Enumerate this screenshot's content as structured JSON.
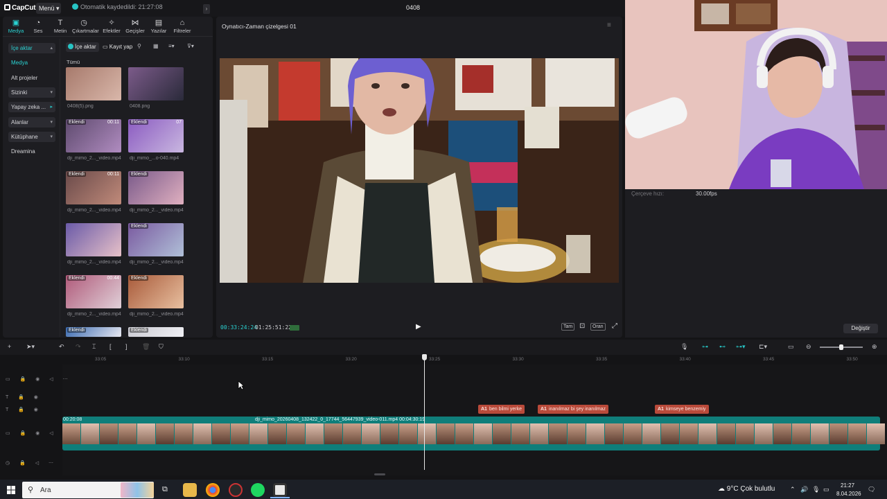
{
  "titlebar": {
    "logo": "CapCut",
    "menu_label": "Menü",
    "autosave": "Otomatik kaydedildi: 21:27:08",
    "project_name": "0408"
  },
  "tool_tabs": [
    {
      "label": "Medya",
      "icon": "media-icon",
      "glyph": "▣"
    },
    {
      "label": "Ses",
      "icon": "audio-icon",
      "glyph": "◔"
    },
    {
      "label": "Metin",
      "icon": "text-icon",
      "glyph": "T"
    },
    {
      "label": "Çıkartmalar",
      "icon": "sticker-icon",
      "glyph": "◷"
    },
    {
      "label": "Efektler",
      "icon": "effects-icon",
      "glyph": "✧"
    },
    {
      "label": "Geçişler",
      "icon": "transitions-icon",
      "glyph": "⋈"
    },
    {
      "label": "Yazılar",
      "icon": "captions-icon",
      "glyph": "▤"
    },
    {
      "label": "Filtreler",
      "icon": "filters-icon",
      "glyph": "⌂"
    }
  ],
  "sidebar": {
    "items": [
      {
        "label": "İçe aktar",
        "chev": "▴"
      },
      {
        "label": "Medya",
        "chev": ""
      },
      {
        "label": "Alt projeler",
        "chev": ""
      },
      {
        "label": "Sizinki",
        "chev": "▾"
      },
      {
        "label": "Yapay zeka ...",
        "chev": "▸"
      },
      {
        "label": "Alanlar",
        "chev": "▾"
      },
      {
        "label": "Kütüphane",
        "chev": "▾"
      },
      {
        "label": "Dreamina",
        "chev": ""
      }
    ]
  },
  "media": {
    "import_label": "İçe aktar",
    "record_label": "Kayıt yap",
    "all_label": "Tümü",
    "items": [
      {
        "name": "0408(5).png",
        "badge": "",
        "dur": ""
      },
      {
        "name": "0408.png",
        "badge": "",
        "dur": ""
      },
      {
        "name": "dji_mimo_2..._video.mp4",
        "badge": "Eklendi",
        "dur": "00:11"
      },
      {
        "name": "dji_mimo_...o-040.mp4",
        "badge": "Eklendi",
        "dur": "07"
      },
      {
        "name": "dji_mimo_2..._video.mp4",
        "badge": "Eklendi",
        "dur": "00:11"
      },
      {
        "name": "dji_mimo_2..._video.mp4",
        "badge": "Eklendi",
        "dur": ""
      },
      {
        "name": "dji_mimo_2..._video.mp4",
        "badge": "",
        "dur": ""
      },
      {
        "name": "dji_mimo_2..._video.mp4",
        "badge": "Eklendi",
        "dur": ""
      },
      {
        "name": "dji_mimo_2..._video.mp4",
        "badge": "Eklendi",
        "dur": "00:44"
      },
      {
        "name": "dji_mimo_2..._video.mp4",
        "badge": "Eklendi",
        "dur": ""
      },
      {
        "name": "",
        "badge": "Eklendi",
        "dur": ""
      },
      {
        "name": "",
        "badge": "Eklendi",
        "dur": ""
      }
    ]
  },
  "player": {
    "title": "Oynatıcı-Zaman çizelgesi 01",
    "current_time": "00:33:24:24",
    "total_time": "01:25:51:22",
    "btn_full": "Tam",
    "btn_ratio": "Oran"
  },
  "props": {
    "fps_label": "Çerçeve hızı:",
    "fps_value": "30.00fps",
    "change_label": "Değiştir"
  },
  "timeline": {
    "ticks": [
      "33:05",
      "33:10",
      "33:15",
      "33:20",
      "33:25",
      "33:30",
      "33:35",
      "33:40",
      "33:45",
      "33:50"
    ],
    "clip_start_label": "00:20:08",
    "clip_main_label": "dji_mimo_20260408_132422_0_17744_56447939_video-011.mp4   00:04:30:19",
    "text_clips": [
      "ben bilmi yerke",
      "inanılmaz bi şey inanılmaz",
      "kimseye benzemiy"
    ],
    "text_prefix": "A1"
  },
  "taskbar": {
    "search_placeholder": "Ara",
    "weather": "9°C  Çok bulutlu",
    "time": "21:27",
    "date": "8.04.2026"
  },
  "colors": {
    "accent": "#27c4c4",
    "text_clip": "#b94a3a",
    "video_track": "#0f7e7a"
  }
}
